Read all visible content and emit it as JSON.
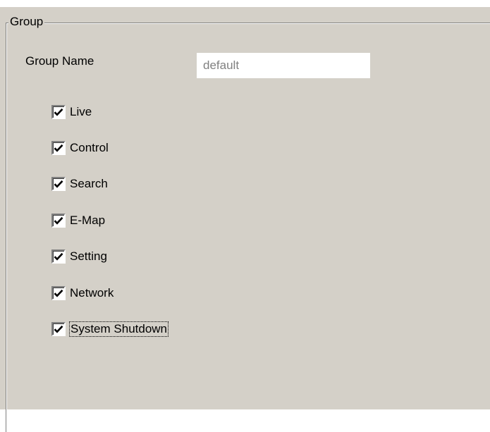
{
  "group": {
    "title": "Group",
    "name_label": "Group Name",
    "name_value": "default"
  },
  "permissions": [
    {
      "label": "Live",
      "checked": true
    },
    {
      "label": "Control",
      "checked": true
    },
    {
      "label": "Search",
      "checked": true
    },
    {
      "label": "E-Map",
      "checked": true
    },
    {
      "label": "Setting",
      "checked": true
    },
    {
      "label": "Network",
      "checked": true
    },
    {
      "label": "System Shutdown",
      "checked": true
    }
  ]
}
